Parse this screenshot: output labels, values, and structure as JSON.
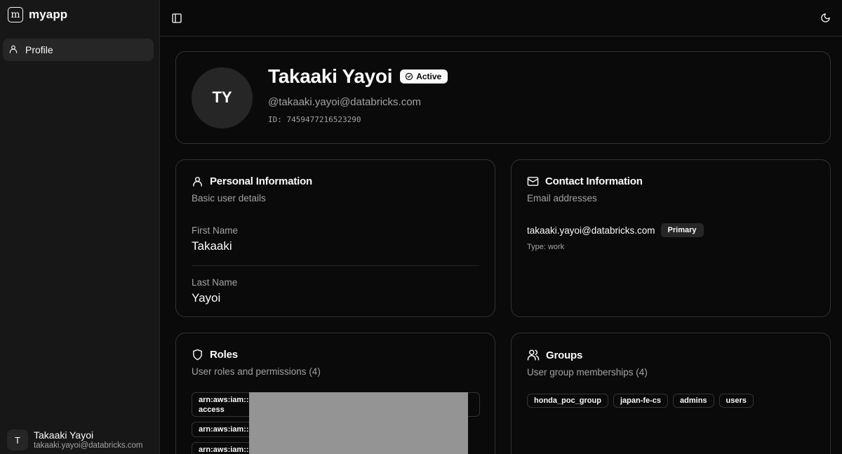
{
  "app": {
    "logo_letter": "m",
    "name": "myapp"
  },
  "sidebar": {
    "items": [
      {
        "label": "Profile",
        "icon": "user-icon"
      }
    ],
    "user": {
      "initial": "T",
      "name": "Takaaki Yayoi",
      "email": "takaaki.yayoi@databricks.com"
    }
  },
  "profile": {
    "initials": "TY",
    "name": "Takaaki Yayoi",
    "status": "Active",
    "handle": "@takaaki.yayoi@databricks.com",
    "id_text": "ID: 7459477216523290"
  },
  "personal": {
    "title": "Personal Information",
    "description": "Basic user details",
    "first_name_label": "First Name",
    "first_name": "Takaaki",
    "last_name_label": "Last Name",
    "last_name": "Yayoi"
  },
  "contact": {
    "title": "Contact Information",
    "description": "Email addresses",
    "email": "takaaki.yayoi@databricks.com",
    "badge": "Primary",
    "type_text": "Type: work"
  },
  "roles": {
    "title": "Roles",
    "description": "User roles and permissions (4)",
    "items": [
      {
        "line1": "arn:aws:iam::",
        "line2": "access"
      },
      {
        "line1": "arn:aws:iam::"
      },
      {
        "line1": "arn:aws:iam::"
      }
    ]
  },
  "groups": {
    "title": "Groups",
    "description": "User group memberships (4)",
    "items": [
      "honda_poc_group",
      "japan-fe-cs",
      "admins",
      "users"
    ]
  }
}
